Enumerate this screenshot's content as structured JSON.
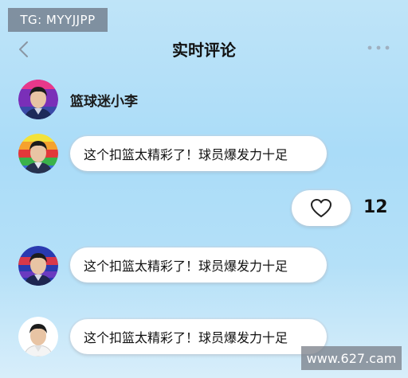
{
  "watermark_top": "TG: MYYJJPP",
  "header": {
    "title": "实时评论",
    "back_icon": "chevron-left-icon",
    "more_icon": "more-dots-icon"
  },
  "poster": {
    "username": "篮球迷小李"
  },
  "comments": [
    {
      "text": "这个扣篮太精彩了！球员爆发力十足"
    },
    {
      "text": "这个扣篮太精彩了！球员爆发力十足"
    },
    {
      "text": "这个扣篮太精彩了！球员爆发力十足"
    }
  ],
  "like": {
    "icon": "heart-icon",
    "count": "12"
  },
  "watermark_bottom": "www.627.cam",
  "colors": {
    "background_top": "#bfe4f8",
    "background_bottom": "#d8eefa",
    "bubble": "#ffffff",
    "watermark": "#6e7887"
  }
}
